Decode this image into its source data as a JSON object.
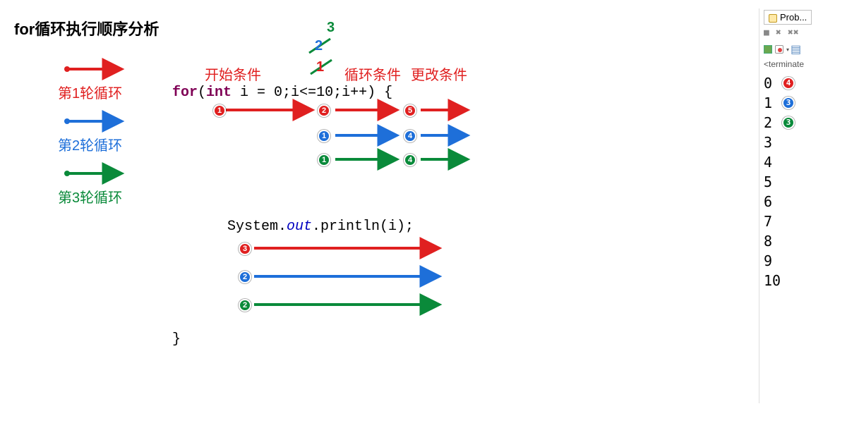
{
  "title": "for循环执行顺序分析",
  "legend": {
    "loop1": "第1轮循环",
    "loop2": "第2轮循环",
    "loop3": "第3轮循环"
  },
  "labels": {
    "start_condition": "开始条件",
    "loop_condition": "循环条件",
    "update_condition": "更改条件"
  },
  "strikeout": {
    "num1": "1",
    "num2": "2",
    "num3": "3"
  },
  "code": {
    "line1_pre": "for",
    "line1_mid_open": "(",
    "line1_kw_int": "int",
    "line1_rest": " i = 0;i<=10;i++) {",
    "line2_pre": "System.",
    "line2_out": "out",
    "line2_post": ".println(i);",
    "line3": "}"
  },
  "badges": {
    "row1": [
      "1",
      "2",
      "5"
    ],
    "row2": [
      "1",
      "4"
    ],
    "row3": [
      "1",
      "4"
    ],
    "println_red": "3",
    "println_blue": "2",
    "println_green": "2"
  },
  "console": {
    "tab_label": "Prob...",
    "toolbar_x": "✖",
    "toolbar_xx": "✖✖",
    "status": "<terminate",
    "output": [
      "0",
      "1",
      "2",
      "3",
      "4",
      "5",
      "6",
      "7",
      "8",
      "9",
      "10"
    ],
    "output_badges": {
      "0": "4",
      "1": "3",
      "2": "3"
    }
  },
  "colors": {
    "red": "#e02020",
    "blue": "#1e6fd9",
    "green": "#0a8a3a"
  }
}
